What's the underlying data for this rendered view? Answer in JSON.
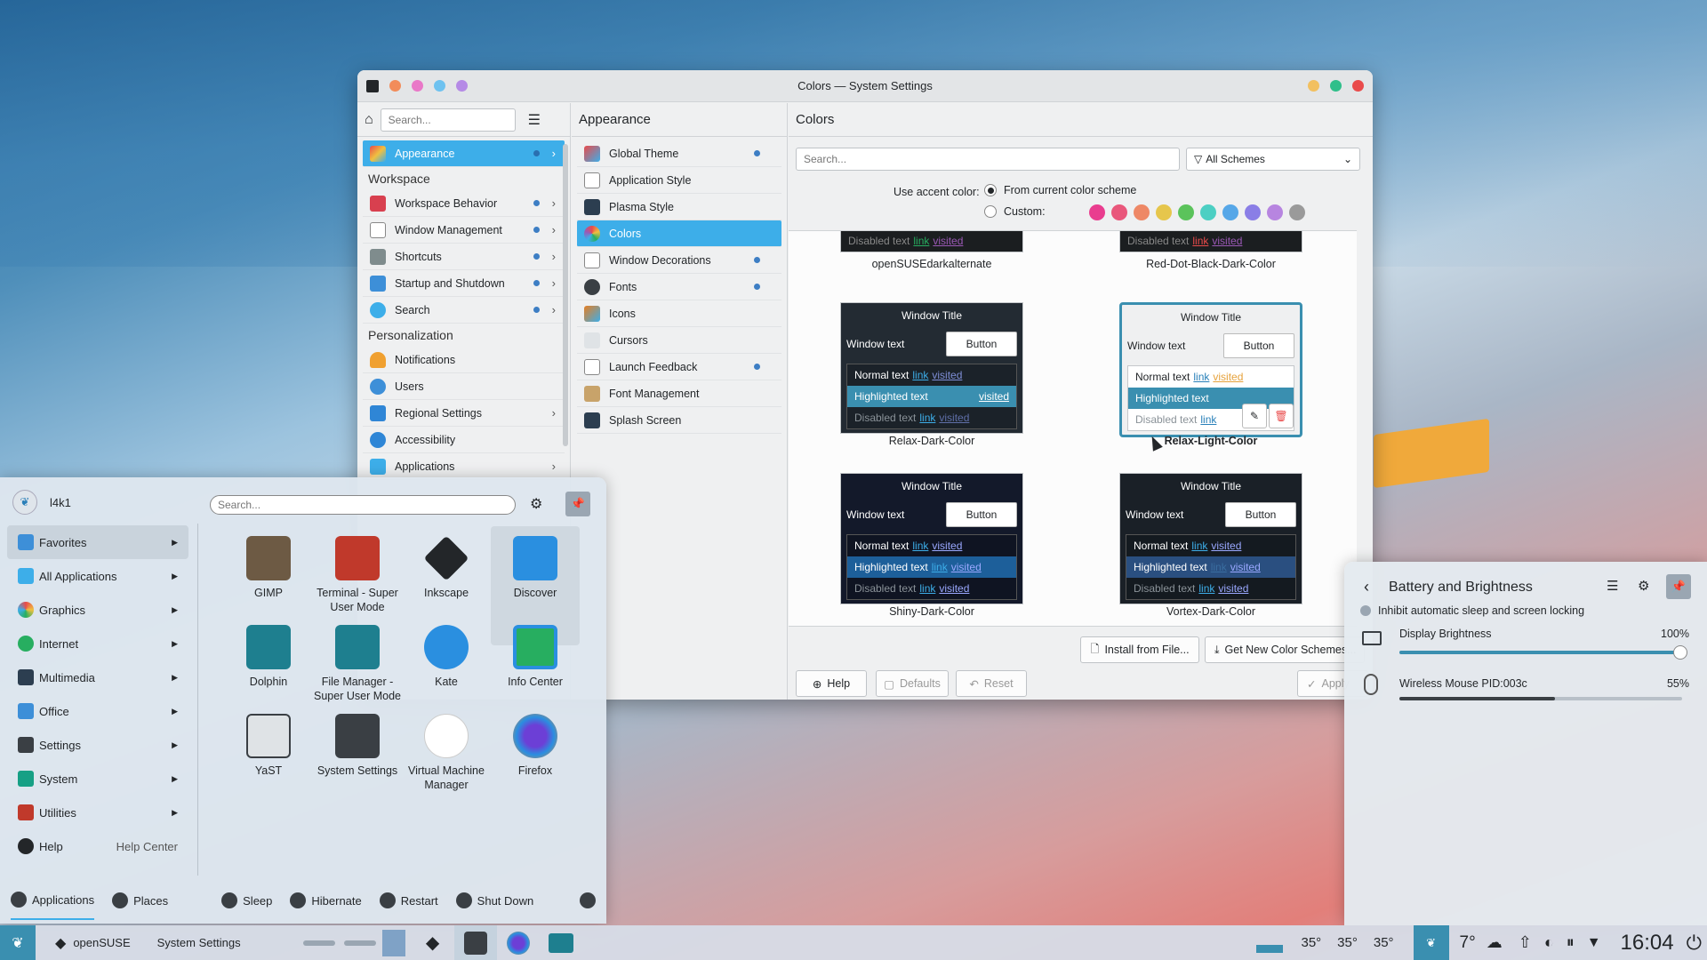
{
  "settings_window": {
    "title": "Colors — System Settings",
    "sidebar": {
      "search_placeholder": "Search...",
      "top_item": "Appearance",
      "sections": [
        {
          "heading": "Workspace",
          "items": [
            "Workspace Behavior",
            "Window Management",
            "Shortcuts",
            "Startup and Shutdown",
            "Search"
          ]
        },
        {
          "heading": "Personalization",
          "items": [
            "Notifications",
            "Users",
            "Regional Settings",
            "Accessibility",
            "Applications"
          ]
        }
      ]
    },
    "appearance": {
      "heading": "Appearance",
      "items": [
        "Global Theme",
        "Application Style",
        "Plasma Style",
        "Colors",
        "Window Decorations",
        "Fonts",
        "Icons",
        "Cursors",
        "Launch Feedback",
        "Font Management",
        "Splash Screen"
      ],
      "selected": "Colors"
    },
    "colors": {
      "heading": "Colors",
      "search_placeholder": "Search...",
      "filter": "All Schemes",
      "accent_label": "Use accent color:",
      "accent_option_current": "From current color scheme",
      "accent_option_custom": "Custom:",
      "swatches": [
        "#e93d8f",
        "#e9577b",
        "#ee8866",
        "#e6c64c",
        "#5bc35b",
        "#4ccfc3",
        "#56a7e8",
        "#8a7ee6",
        "#b785e0",
        "#9a9a9a"
      ],
      "top_partial": [
        {
          "name": "openSUSEdarkalternate",
          "line": {
            "label": "Disabled text",
            "link": "link",
            "visited": "visited"
          }
        },
        {
          "name": "Red-Dot-Black-Dark-Color",
          "line": {
            "label": "Disabled text",
            "link": "link",
            "visited": "visited"
          }
        }
      ],
      "schemes": [
        {
          "name": "Relax-Dark-Color",
          "window_title": "Window Title",
          "window_text": "Window text",
          "button": "Button",
          "normal": "Normal text",
          "highlighted": "Highlighted text",
          "disabled": "Disabled text",
          "link": "link",
          "visited": "visited"
        },
        {
          "name": "Relax-Light-Color",
          "window_title": "Window Title",
          "window_text": "Window text",
          "button": "Button",
          "normal": "Normal text",
          "highlighted": "Highlighted text",
          "disabled": "Disabled text",
          "link": "link",
          "visited": "visited"
        },
        {
          "name": "Shiny-Dark-Color",
          "window_title": "Window Title",
          "window_text": "Window text",
          "button": "Button",
          "normal": "Normal text",
          "highlighted": "Highlighted text",
          "disabled": "Disabled text",
          "link": "link",
          "visited": "visited"
        },
        {
          "name": "Vortex-Dark-Color",
          "window_title": "Window Title",
          "window_text": "Window text",
          "button": "Button",
          "normal": "Normal text",
          "highlighted": "Highlighted text",
          "disabled": "Disabled text",
          "link": "link",
          "visited": "visited"
        }
      ],
      "install_btn": "Install from File...",
      "get_new_btn": "Get New Color Schemes...",
      "help_btn": "Help",
      "defaults_btn": "Defaults",
      "reset_btn": "Reset",
      "apply_btn": "Apply"
    }
  },
  "launcher": {
    "user": "l4k1",
    "search_placeholder": "Search...",
    "categories": [
      "Favorites",
      "All Applications",
      "Graphics",
      "Internet",
      "Multimedia",
      "Office",
      "Settings",
      "System",
      "Utilities"
    ],
    "help": "Help",
    "help_center": "Help Center",
    "apps": [
      "GIMP",
      "Terminal - Super User Mode",
      "Inkscape",
      "Discover",
      "Dolphin",
      "File Manager - Super User Mode",
      "Kate",
      "Info Center",
      "YaST",
      "System Settings",
      "Virtual Machine Manager",
      "Firefox"
    ],
    "footer": {
      "applications": "Applications",
      "places": "Places",
      "sleep": "Sleep",
      "hibernate": "Hibernate",
      "restart": "Restart",
      "shutdown": "Shut Down"
    }
  },
  "battery": {
    "title": "Battery and Brightness",
    "inhibit": "Inhibit automatic sleep and screen locking",
    "display_label": "Display Brightness",
    "display_value": "100%",
    "display_level": 1.0,
    "mouse_label": "Wireless Mouse PID:003c",
    "mouse_value": "55%",
    "mouse_level": 0.55
  },
  "taskbar": {
    "opensuse": "openSUSE",
    "system_settings": "System Settings",
    "temps": [
      "35°",
      "35°",
      "35°"
    ],
    "weather": "7°",
    "clock": "16:04"
  }
}
